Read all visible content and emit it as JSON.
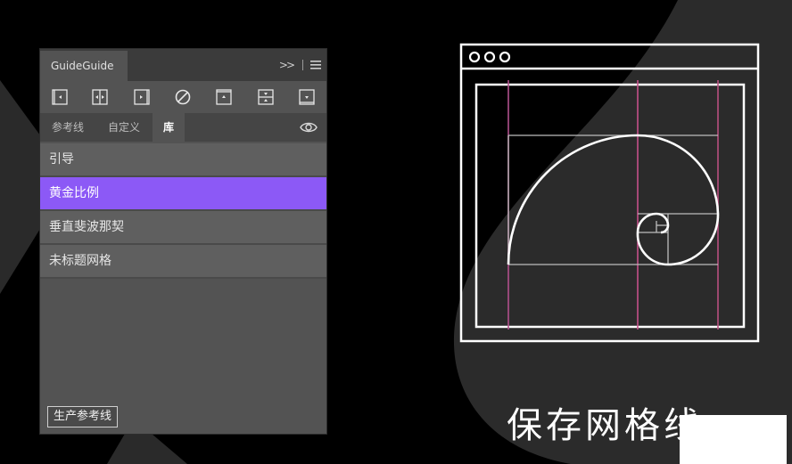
{
  "panel": {
    "title": "GuideGuide",
    "header_chevron": ">>",
    "toolbar_icons": [
      "guide-left-icon",
      "guide-center-vertical-icon",
      "guide-right-icon",
      "clear-icon",
      "guide-top-icon",
      "guide-center-horizontal-icon",
      "guide-bottom-icon"
    ],
    "tabs": [
      {
        "label": "参考线"
      },
      {
        "label": "自定义"
      },
      {
        "label": "库"
      }
    ],
    "active_tab": "库",
    "list_items": [
      {
        "label": "引导"
      },
      {
        "label": "黄金比例"
      },
      {
        "label": "垂直斐波那契"
      },
      {
        "label": "未标题网格"
      }
    ],
    "selected_item": "黄金比例",
    "generate_button": "生产参考线"
  },
  "caption": "保存网格线",
  "colors": {
    "accent": "#8c59f6",
    "panel_bg": "#535353",
    "header_bg": "#3b3b3b",
    "guide_line": "#c0508a"
  }
}
